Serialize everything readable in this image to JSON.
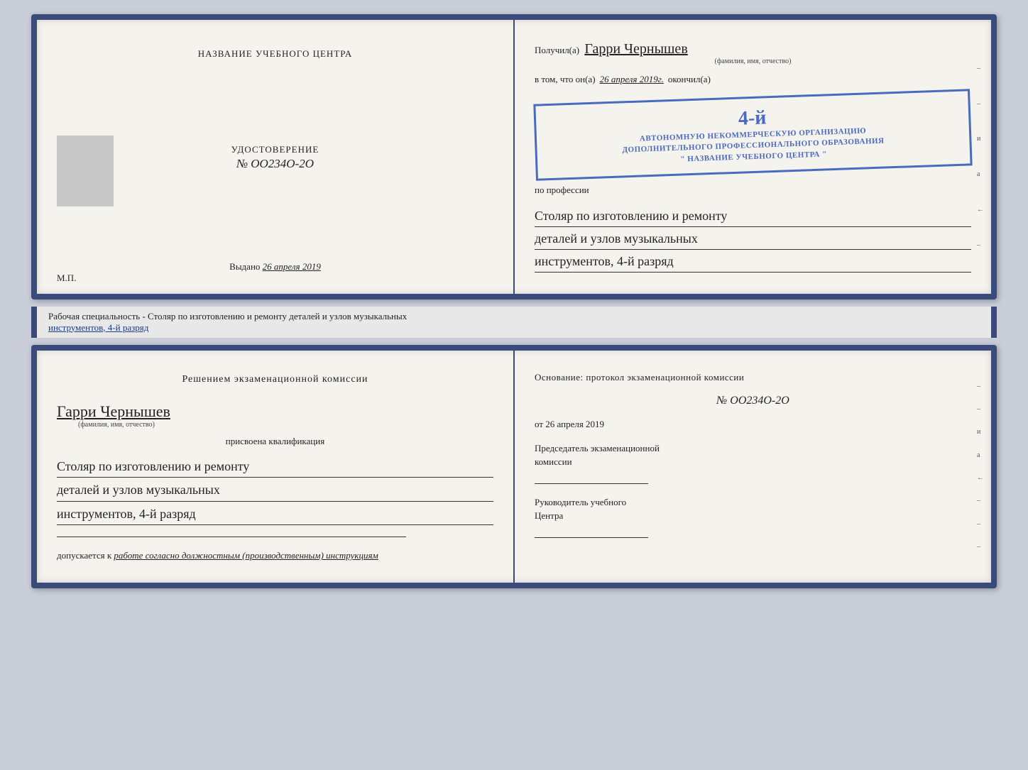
{
  "top_left": {
    "center_title": "НАЗВАНИЕ УЧЕБНОГО ЦЕНТРА",
    "photo_alt": "photo placeholder",
    "cert_label": "УДОСТОВЕРЕНИЕ",
    "cert_number": "№ OO234O-2O",
    "issued_label": "Выдано",
    "issued_date": "26 апреля 2019",
    "mp_label": "М.П."
  },
  "top_right": {
    "received_prefix": "Получил(а)",
    "recipient_name": "Гарри Чернышев",
    "name_subtext": "(фамилия, имя, отчество)",
    "vtom_prefix": "в том, что он(а)",
    "vtom_date": "26 апреля 2019г.",
    "okoncil": "окончил(а)",
    "stamp_rank": "4-й",
    "stamp_line1": "АВТОНОМНУЮ НЕКОММЕРЧЕСКУЮ ОРГАНИЗАЦИЮ",
    "stamp_line2": "ДОПОЛНИТЕЛЬНОГО ПРОФЕССИОНАЛЬНОГО ОБРАЗОВАНИЯ",
    "stamp_line3": "\" НАЗВАНИЕ УЧЕБНОГО ЦЕНТРА \"",
    "po_professii": "по профессии",
    "profession_line1": "Столяр по изготовлению и ремонту",
    "profession_line2": "деталей и узлов музыкальных",
    "profession_line3": "инструментов, 4-й разряд"
  },
  "specialty_bar": {
    "prefix": "Рабочая специальность - Столяр по изготовлению и ремонту деталей и узлов музыкальных",
    "underline_text": "инструментов, 4-й разряд"
  },
  "bottom_left": {
    "commission_title": "Решением  экзаменационной  комиссии",
    "recipient_name": "Гарри Чернышев",
    "name_subtext": "(фамилия, имя, отчество)",
    "assigned_label": "присвоена квалификация",
    "profession_line1": "Столяр по изготовлению и ремонту",
    "profession_line2": "деталей и узлов музыкальных",
    "profession_line3": "инструментов, 4-й разряд",
    "admitted_prefix": "допускается к",
    "admitted_text": "работе согласно должностным (производственным) инструкциям"
  },
  "bottom_right": {
    "osnov_title": "Основание: протокол экзаменационной  комиссии",
    "protocol_number": "№  OO234O-2O",
    "protocol_date_prefix": "от",
    "protocol_date": "26 апреля 2019",
    "chairman_line1": "Председатель экзаменационной",
    "chairman_line2": "комиссии",
    "director_line1": "Руководитель учебного",
    "director_line2": "Центра"
  },
  "side_chars": [
    "и",
    "а",
    "←",
    "–",
    "–",
    "–",
    "–"
  ]
}
